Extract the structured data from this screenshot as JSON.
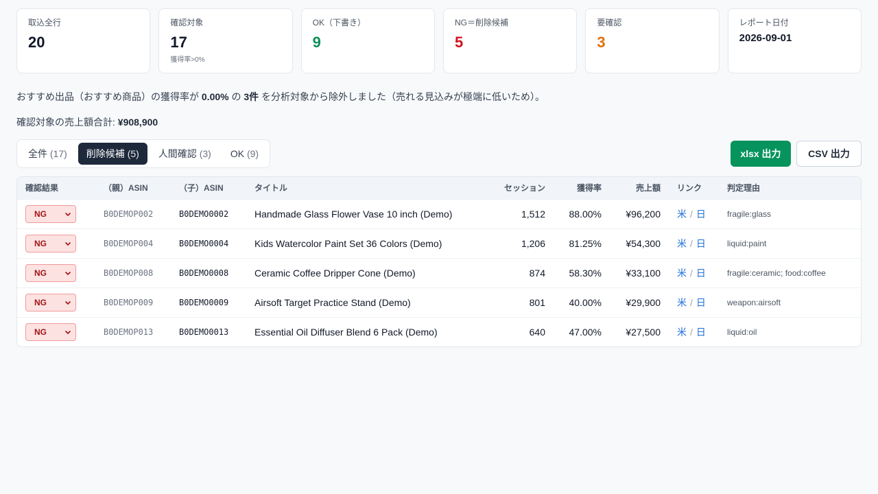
{
  "cards": [
    {
      "label": "取込全行",
      "value": "20"
    },
    {
      "label": "確認対象",
      "value": "17",
      "sub": "獲得率>0%"
    },
    {
      "label": "OK（下書き）",
      "value": "9"
    },
    {
      "label": "NG＝削除候補",
      "value": "5"
    },
    {
      "label": "要確認",
      "value": "3"
    },
    {
      "label": "レポート日付",
      "value": "2026-09-01"
    }
  ],
  "notice": {
    "prefix": "おすすめ出品（おすすめ商品）の獲得率が ",
    "rate": "0.00%",
    "mid": " の ",
    "count": "3件",
    "suffix": " を分析対象から除外しました（売れる見込みが極端に低いため）。"
  },
  "total": {
    "label": "確認対象の売上額合計: ",
    "value": "¥908,900"
  },
  "tabs": [
    {
      "label": "全件",
      "count": "(17)"
    },
    {
      "label": "削除候補",
      "count": "(5)"
    },
    {
      "label": "人間確認",
      "count": "(3)"
    },
    {
      "label": "OK",
      "count": "(9)"
    }
  ],
  "buttons": {
    "xlsx": "xlsx 出力",
    "csv": "CSV 出力"
  },
  "table": {
    "headers": [
      "確認結果",
      "（親）ASIN",
      "（子）ASIN",
      "タイトル",
      "セッション",
      "獲得率",
      "売上額",
      "リンク",
      "判定理由"
    ],
    "link_us": "米",
    "link_jp": "日",
    "link_sep": "/",
    "rows": [
      {
        "result": "NG",
        "parent": "B0DEMOP002",
        "child": "B0DEMO0002",
        "title": "Handmade Glass Flower Vase 10 inch (Demo)",
        "sessions": "1,512",
        "rate": "88.00%",
        "sales": "¥96,200",
        "reason": "fragile:glass"
      },
      {
        "result": "NG",
        "parent": "B0DEMOP004",
        "child": "B0DEMO0004",
        "title": "Kids Watercolor Paint Set 36 Colors (Demo)",
        "sessions": "1,206",
        "rate": "81.25%",
        "sales": "¥54,300",
        "reason": "liquid:paint"
      },
      {
        "result": "NG",
        "parent": "B0DEMOP008",
        "child": "B0DEMO0008",
        "title": "Ceramic Coffee Dripper Cone (Demo)",
        "sessions": "874",
        "rate": "58.30%",
        "sales": "¥33,100",
        "reason": "fragile:ceramic; food:coffee"
      },
      {
        "result": "NG",
        "parent": "B0DEMOP009",
        "child": "B0DEMO0009",
        "title": "Airsoft Target Practice Stand (Demo)",
        "sessions": "801",
        "rate": "40.00%",
        "sales": "¥29,900",
        "reason": "weapon:airsoft"
      },
      {
        "result": "NG",
        "parent": "B0DEMOP013",
        "child": "B0DEMO0013",
        "title": "Essential Oil Diffuser Blend 6 Pack (Demo)",
        "sessions": "640",
        "rate": "47.00%",
        "sales": "¥27,500",
        "reason": "liquid:oil"
      }
    ]
  }
}
